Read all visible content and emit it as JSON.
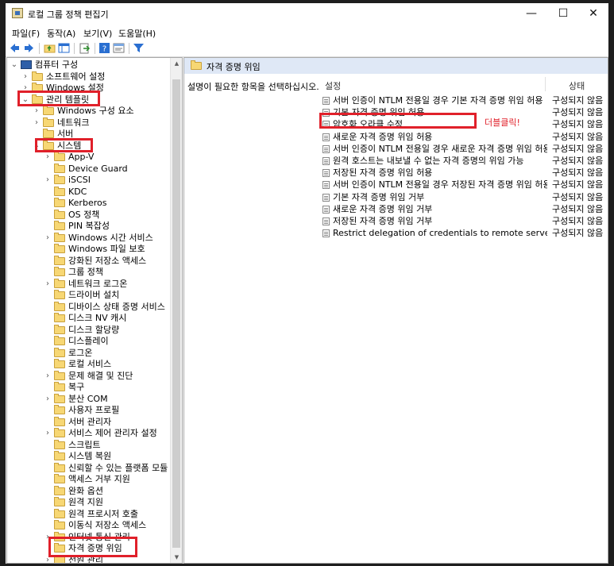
{
  "window": {
    "title": "로컬 그룹 정책 편집기",
    "controls": [
      "—",
      "☐",
      "✕"
    ]
  },
  "menu": [
    "파일(F)",
    "동작(A)",
    "보기(V)",
    "도움말(H)"
  ],
  "toolbar": {
    "icons": [
      "back-arrow-icon",
      "forward-arrow-icon",
      "up-folder-icon",
      "show-tree-icon",
      "export-list-icon",
      "help-icon",
      "properties-icon",
      "filter-icon"
    ]
  },
  "tree": [
    {
      "label": "컴퓨터 구성",
      "level": 0,
      "expander": "open",
      "icon": "computer"
    },
    {
      "label": "소프트웨어 설정",
      "level": 1,
      "expander": "closed",
      "icon": "folder"
    },
    {
      "label": "Windows 설정",
      "level": 1,
      "expander": "closed",
      "icon": "folder"
    },
    {
      "label": "관리 템플릿",
      "level": 1,
      "expander": "open",
      "icon": "folder"
    },
    {
      "label": "Windows 구성 요소",
      "level": 2,
      "expander": "closed",
      "icon": "folder"
    },
    {
      "label": "네트워크",
      "level": 2,
      "expander": "closed",
      "icon": "folder"
    },
    {
      "label": "서버",
      "level": 2,
      "expander": "none",
      "icon": "folder"
    },
    {
      "label": "시스템",
      "level": 2,
      "expander": "open",
      "icon": "folder"
    },
    {
      "label": "App-V",
      "level": 3,
      "expander": "closed",
      "icon": "folder"
    },
    {
      "label": "Device Guard",
      "level": 3,
      "expander": "none",
      "icon": "folder"
    },
    {
      "label": "iSCSI",
      "level": 3,
      "expander": "closed",
      "icon": "folder"
    },
    {
      "label": "KDC",
      "level": 3,
      "expander": "none",
      "icon": "folder"
    },
    {
      "label": "Kerberos",
      "level": 3,
      "expander": "none",
      "icon": "folder"
    },
    {
      "label": "OS 정책",
      "level": 3,
      "expander": "none",
      "icon": "folder"
    },
    {
      "label": "PIN 복잡성",
      "level": 3,
      "expander": "none",
      "icon": "folder"
    },
    {
      "label": "Windows 시간 서비스",
      "level": 3,
      "expander": "closed",
      "icon": "folder"
    },
    {
      "label": "Windows 파일 보호",
      "level": 3,
      "expander": "none",
      "icon": "folder"
    },
    {
      "label": "강화된 저장소 액세스",
      "level": 3,
      "expander": "none",
      "icon": "folder"
    },
    {
      "label": "그룹 정책",
      "level": 3,
      "expander": "none",
      "icon": "folder"
    },
    {
      "label": "네트워크 로그온",
      "level": 3,
      "expander": "closed",
      "icon": "folder"
    },
    {
      "label": "드라이버 설치",
      "level": 3,
      "expander": "none",
      "icon": "folder"
    },
    {
      "label": "디바이스 상태 증명 서비스",
      "level": 3,
      "expander": "none",
      "icon": "folder"
    },
    {
      "label": "디스크 NV 캐시",
      "level": 3,
      "expander": "none",
      "icon": "folder"
    },
    {
      "label": "디스크 할당량",
      "level": 3,
      "expander": "none",
      "icon": "folder"
    },
    {
      "label": "디스플레이",
      "level": 3,
      "expander": "none",
      "icon": "folder"
    },
    {
      "label": "로그온",
      "level": 3,
      "expander": "none",
      "icon": "folder"
    },
    {
      "label": "로컬 서비스",
      "level": 3,
      "expander": "none",
      "icon": "folder"
    },
    {
      "label": "문제 해결 및 진단",
      "level": 3,
      "expander": "closed",
      "icon": "folder"
    },
    {
      "label": "복구",
      "level": 3,
      "expander": "none",
      "icon": "folder"
    },
    {
      "label": "분산 COM",
      "level": 3,
      "expander": "closed",
      "icon": "folder"
    },
    {
      "label": "사용자 프로필",
      "level": 3,
      "expander": "none",
      "icon": "folder"
    },
    {
      "label": "서버 관리자",
      "level": 3,
      "expander": "none",
      "icon": "folder"
    },
    {
      "label": "서비스 제어 관리자 설정",
      "level": 3,
      "expander": "closed",
      "icon": "folder"
    },
    {
      "label": "스크립트",
      "level": 3,
      "expander": "none",
      "icon": "folder"
    },
    {
      "label": "시스템 복원",
      "level": 3,
      "expander": "none",
      "icon": "folder"
    },
    {
      "label": "신뢰할 수 있는 플랫폼 모듈",
      "level": 3,
      "expander": "none",
      "icon": "folder"
    },
    {
      "label": "액세스 거부 지원",
      "level": 3,
      "expander": "none",
      "icon": "folder"
    },
    {
      "label": "완화 옵션",
      "level": 3,
      "expander": "none",
      "icon": "folder"
    },
    {
      "label": "원격 지원",
      "level": 3,
      "expander": "none",
      "icon": "folder"
    },
    {
      "label": "원격 프로시저 호출",
      "level": 3,
      "expander": "none",
      "icon": "folder"
    },
    {
      "label": "이동식 저장소 액세스",
      "level": 3,
      "expander": "none",
      "icon": "folder"
    },
    {
      "label": "인터넷 통신 관리",
      "level": 3,
      "expander": "closed",
      "icon": "folder"
    },
    {
      "label": "자격 증명 위임",
      "level": 3,
      "expander": "none",
      "icon": "folder"
    },
    {
      "label": "전원 관리",
      "level": 3,
      "expander": "closed",
      "icon": "folder"
    }
  ],
  "right": {
    "header_title": "자격 증명 위임",
    "description": "설명이 필요한 항목을 선택하십시오.",
    "col_setting": "설정",
    "col_state": "상태",
    "rows": [
      {
        "setting": "서버 인증이 NTLM 전용일 경우 기본 자격 증명 위임 허용",
        "state": "구성되지 않음"
      },
      {
        "setting": "기본 자격 증명 위임 허용",
        "state": "구성되지 않음"
      },
      {
        "setting": "암호화 오라클 수정",
        "state": "구성되지 않음"
      },
      {
        "setting": "새로운 자격 증명 위임 허용",
        "state": "구성되지 않음"
      },
      {
        "setting": "서버 인증이 NTLM 전용일 경우 새로운 자격 증명 위임 허용",
        "state": "구성되지 않음"
      },
      {
        "setting": "원격 호스트는 내보낼 수 없는 자격 증명의 위임 가능",
        "state": "구성되지 않음"
      },
      {
        "setting": "저장된 자격 증명 위임 허용",
        "state": "구성되지 않음"
      },
      {
        "setting": "서버 인증이 NTLM 전용일 경우 저장된 자격 증명 위임 허용",
        "state": "구성되지 않음"
      },
      {
        "setting": "기본 자격 증명 위임 거부",
        "state": "구성되지 않음"
      },
      {
        "setting": "새로운 자격 증명 위임 거부",
        "state": "구성되지 않음"
      },
      {
        "setting": "저장된 자격 증명 위임 거부",
        "state": "구성되지 않음"
      },
      {
        "setting": "Restrict delegation of credentials to remote servers(원격 서...",
        "state": "구성되지 않음"
      }
    ]
  },
  "annotation": {
    "text": "더블클릭!",
    "color": "#e0202a"
  },
  "colors": {
    "highlight_box": "#e0202a",
    "header_bg": "#dfe8f6",
    "folder": "#f7d774"
  }
}
